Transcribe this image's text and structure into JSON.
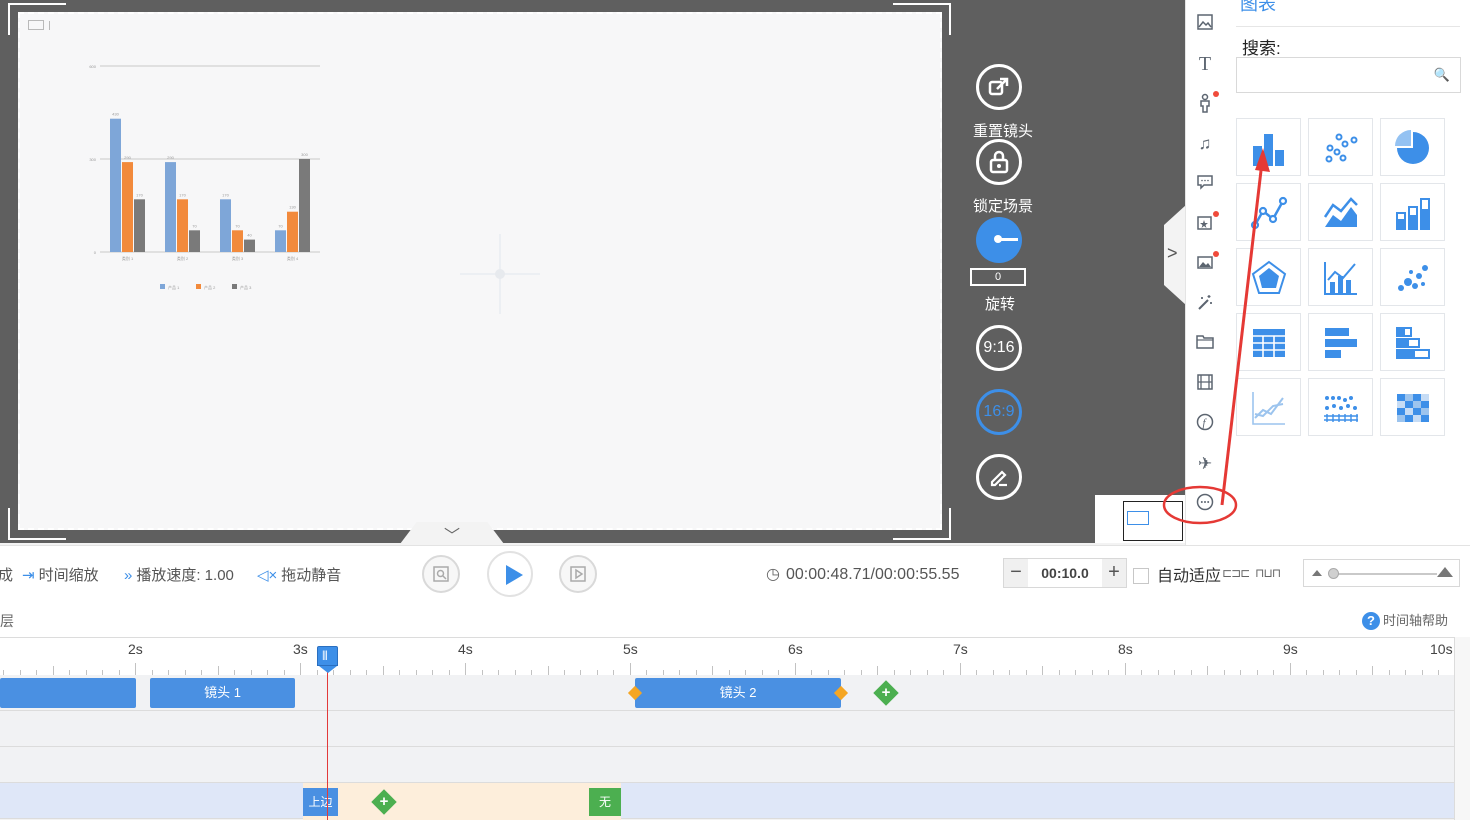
{
  "stage": {
    "controls": {
      "reset_camera": "重置镜头",
      "lock_scene": "锁定场景",
      "rotation_value": "0",
      "rotation_label": "旋转",
      "ratio_916": "9:16",
      "ratio_169": "16:9"
    }
  },
  "panel": {
    "title": "图表",
    "search_label": "搜索:",
    "search_value": ""
  },
  "toolbar": {
    "cut_prefix": "成",
    "time_zoom": "时间缩放",
    "play_speed": "播放速度: 1.00",
    "drag_mute": "拖动静音",
    "time": "00:00:48.71/00:00:55.55",
    "duration_value": "00:10.0",
    "auto_fit": "自动适应"
  },
  "timeline": {
    "left_label": "层",
    "help": "时间轴帮助",
    "ticks": [
      "2s",
      "3s",
      "4s",
      "5s",
      "6s",
      "7s",
      "8s",
      "9s",
      "10s"
    ],
    "clips": {
      "camera1": "镜头 1",
      "camera2": "镜头 2",
      "enter": "上边",
      "exit": "无"
    }
  },
  "chart_data": {
    "type": "bar",
    "categories": [
      "类别 1",
      "类别 2",
      "类别 3",
      "类别 4"
    ],
    "series": [
      {
        "name": "产品 1",
        "values": [
          430,
          290,
          170,
          70
        ]
      },
      {
        "name": "产品 2",
        "values": [
          290,
          170,
          70,
          130
        ]
      },
      {
        "name": "产品 3",
        "values": [
          170,
          70,
          40,
          300
        ]
      }
    ],
    "ylim": [
      0,
      600
    ],
    "colors": [
      "#7ea6d8",
      "#f28a3c",
      "#7a7a7a"
    ]
  },
  "colors": {
    "accent": "#3d8fe8",
    "annotation": "#e53935"
  }
}
